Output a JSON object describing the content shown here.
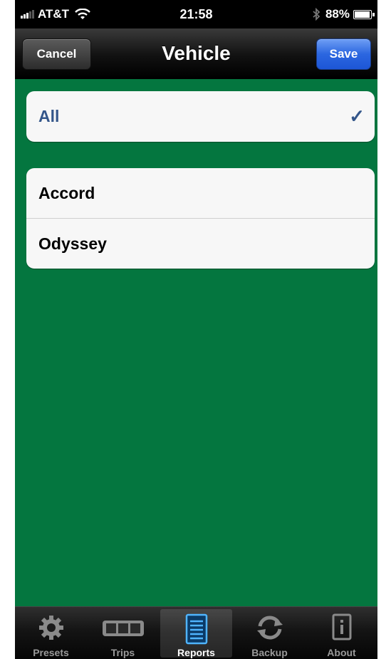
{
  "status_bar": {
    "carrier": "AT&T",
    "time": "21:58",
    "battery": "88%",
    "battery_level": 0.88,
    "icons": [
      "signal-bars-icon",
      "wifi-icon",
      "bluetooth-icon",
      "battery-icon"
    ]
  },
  "nav": {
    "title": "Vehicle",
    "cancel_label": "Cancel",
    "save_label": "Save"
  },
  "filter": {
    "all_label": "All",
    "all_selected": true,
    "vehicles": [
      "Accord",
      "Odyssey"
    ]
  },
  "tabs": [
    {
      "label": "Presets",
      "icon": "gear-icon",
      "active": false
    },
    {
      "label": "Trips",
      "icon": "trips-icon",
      "active": false
    },
    {
      "label": "Reports",
      "icon": "reports-icon",
      "active": true
    },
    {
      "label": "Backup",
      "icon": "sync-icon",
      "active": false
    },
    {
      "label": "About",
      "icon": "info-icon",
      "active": false
    }
  ],
  "colors": {
    "background": "#04763f",
    "selected_text": "#34568a",
    "save_button": "#2b66e0"
  }
}
